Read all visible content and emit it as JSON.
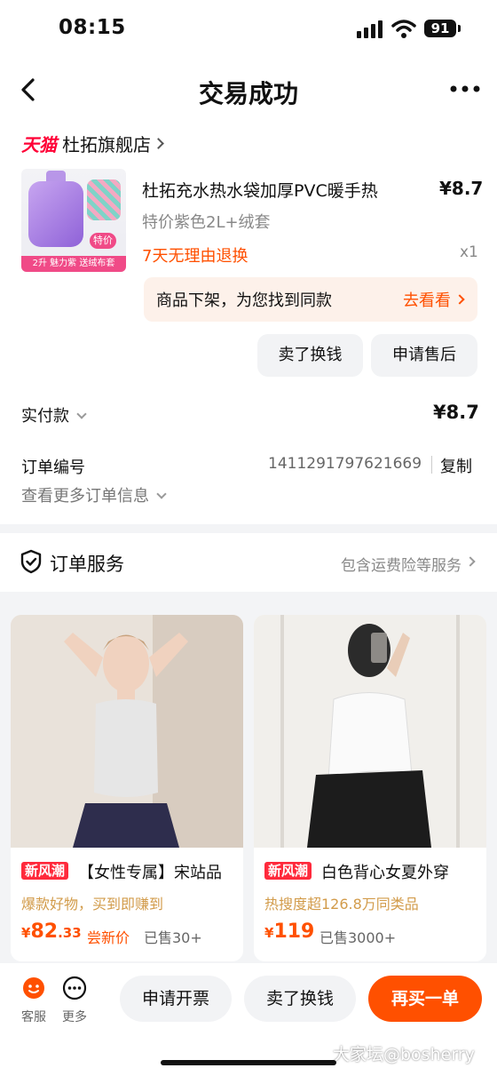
{
  "status_bar": {
    "time": "08:15",
    "battery": "91"
  },
  "nav": {
    "title": "交易成功"
  },
  "shop": {
    "brand": "天猫",
    "name": "杜拓旗舰店"
  },
  "product": {
    "title": "杜拓充水热水袋加厚PVC暖手热",
    "price": "¥8.7",
    "sku": "特价紫色2L+绒套",
    "return_policy": "7天无理由退换",
    "quantity": "x1",
    "thumb_tag": "特价",
    "thumb_strip": "2升 魅力紫 送绒布套"
  },
  "notice": {
    "text": "商品下架，为您找到同款",
    "action": "去看看"
  },
  "actions": {
    "sell": "卖了换钱",
    "after_sale": "申请售后"
  },
  "payment": {
    "label": "实付款",
    "value": "¥8.7"
  },
  "order": {
    "label": "订单编号",
    "number": "1411291797621669",
    "copy": "复制",
    "more": "查看更多订单信息"
  },
  "service": {
    "label": "订单服务",
    "link": "包含运费险等服务"
  },
  "recommendations": [
    {
      "tag": "新风潮",
      "title": "【女性专属】宋站品",
      "subtitle": "爆款好物，买到即赚到",
      "currency": "¥",
      "price_int": "82",
      "price_dec": ".33",
      "note": "尝新价",
      "sold": "已售30+"
    },
    {
      "tag": "新风潮",
      "title": "白色背心女夏外穿",
      "subtitle": "热搜度超126.8万同类品",
      "currency": "¥",
      "price_int": "119",
      "price_dec": "",
      "note": "",
      "sold": "已售3000+"
    }
  ],
  "bottom": {
    "service": "客服",
    "more": "更多",
    "invoice": "申请开票",
    "sell": "卖了换钱",
    "buy_again": "再买一单"
  },
  "watermark": "大家坛@bosherry",
  "colors": {
    "accent": "#ff5000",
    "tmall": "#ff0036",
    "tag": "#ff2a3c"
  }
}
